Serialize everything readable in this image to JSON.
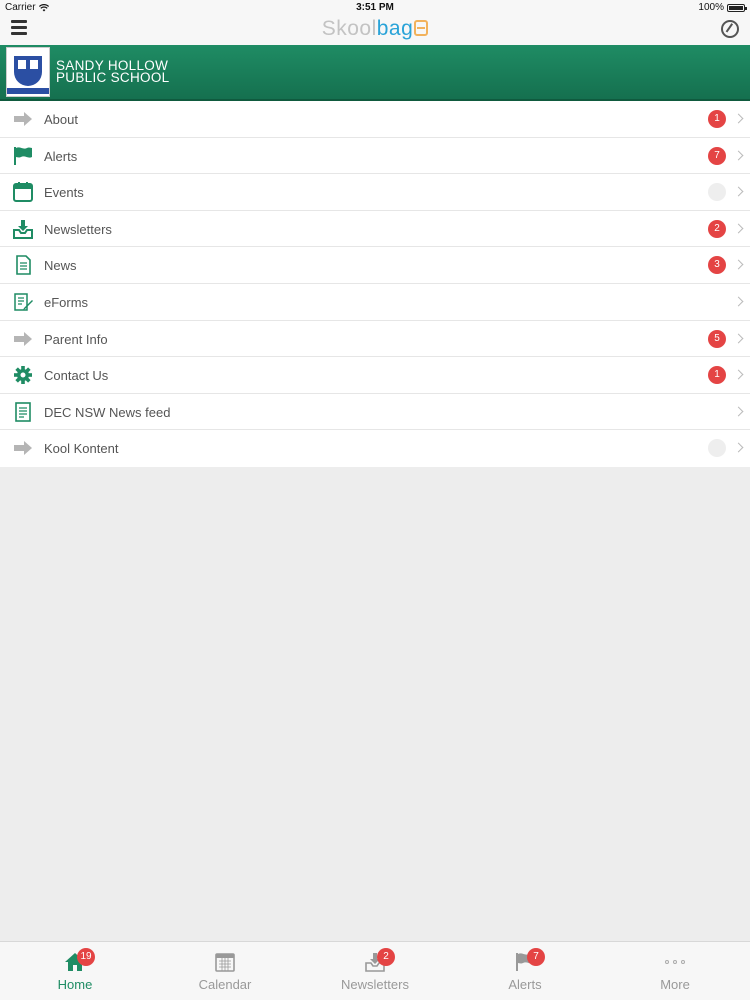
{
  "status_bar": {
    "carrier": "Carrier",
    "time": "3:51 PM",
    "battery": "100%"
  },
  "nav": {
    "brand_part1": "Skool",
    "brand_part2": "bag"
  },
  "school": {
    "name_line1": "SANDY HOLLOW",
    "name_line2": "PUBLIC SCHOOL"
  },
  "colors": {
    "accent": "#1f8c64",
    "badge": "#e44444",
    "brand_blue": "#29a3d8"
  },
  "menu": [
    {
      "label": "About",
      "icon": "arrow-right-icon",
      "badge": "1"
    },
    {
      "label": "Alerts",
      "icon": "flag-icon",
      "badge": "7"
    },
    {
      "label": "Events",
      "icon": "calendar-icon",
      "badge": ""
    },
    {
      "label": "Newsletters",
      "icon": "inbox-download-icon",
      "badge": "2"
    },
    {
      "label": "News",
      "icon": "document-icon",
      "badge": "3"
    },
    {
      "label": "eForms",
      "icon": "form-edit-icon",
      "badge": null
    },
    {
      "label": "Parent Info",
      "icon": "arrow-right-icon",
      "badge": "5"
    },
    {
      "label": "Contact Us",
      "icon": "gear-icon",
      "badge": "1"
    },
    {
      "label": "DEC NSW News feed",
      "icon": "document-icon",
      "badge": null
    },
    {
      "label": "Kool Kontent",
      "icon": "arrow-right-icon",
      "badge": ""
    }
  ],
  "tabs": [
    {
      "label": "Home",
      "icon": "home-icon",
      "badge": "19",
      "active": true
    },
    {
      "label": "Calendar",
      "icon": "calendar-icon",
      "badge": null,
      "active": false
    },
    {
      "label": "Newsletters",
      "icon": "inbox-download-icon",
      "badge": "2",
      "active": false
    },
    {
      "label": "Alerts",
      "icon": "flag-icon",
      "badge": "7",
      "active": false
    },
    {
      "label": "More",
      "icon": "more-dots-icon",
      "badge": null,
      "active": false
    }
  ]
}
